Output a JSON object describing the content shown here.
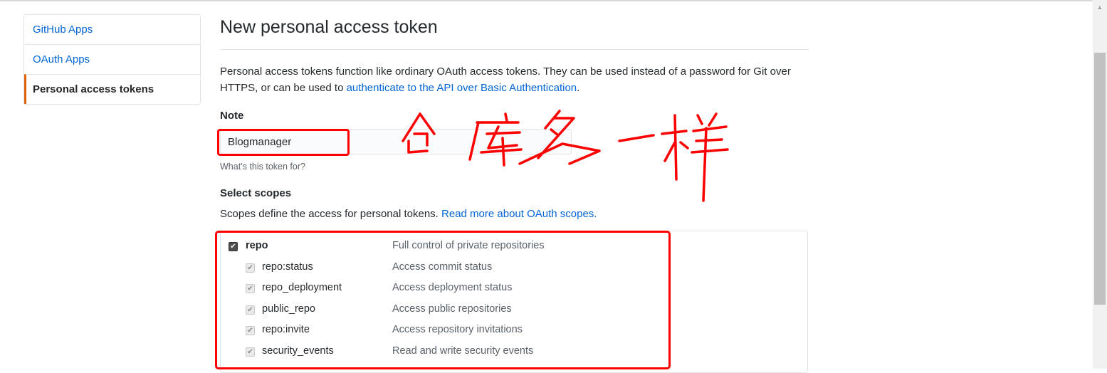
{
  "sidebar": {
    "items": [
      {
        "label": "GitHub Apps"
      },
      {
        "label": "OAuth Apps"
      },
      {
        "label": "Personal access tokens"
      }
    ]
  },
  "main": {
    "title": "New personal access token",
    "description_text": "Personal access tokens function like ordinary OAuth access tokens. They can be used instead of a password for Git over HTTPS, or can be used to ",
    "description_link": "authenticate to the API over Basic Authentication",
    "description_end": ".",
    "note": {
      "label": "Note",
      "value": "Blogmanager",
      "help": "What’s this token for?"
    },
    "scopes": {
      "label": "Select scopes",
      "desc_text": "Scopes define the access for personal tokens. ",
      "desc_link": "Read more about OAuth scopes.",
      "items": [
        {
          "name": "repo",
          "desc": "Full control of private repositories",
          "checked": true
        },
        {
          "name": "repo:status",
          "desc": "Access commit status",
          "checked": true
        },
        {
          "name": "repo_deployment",
          "desc": "Access deployment status",
          "checked": true
        },
        {
          "name": "public_repo",
          "desc": "Access public repositories",
          "checked": true
        },
        {
          "name": "repo:invite",
          "desc": "Access repository invitations",
          "checked": true
        },
        {
          "name": "security_events",
          "desc": "Read and write security events",
          "checked": true
        }
      ]
    }
  },
  "annotation": {
    "handwritten_text": "仓库名一样",
    "color": "#ff0000"
  },
  "colors": {
    "link": "#0366d6",
    "selected_accent": "#e36209",
    "text": "#24292e",
    "muted": "#586069"
  },
  "icons": {
    "checkbox": "check-icon",
    "scroll_up": "chevron-up-icon"
  }
}
